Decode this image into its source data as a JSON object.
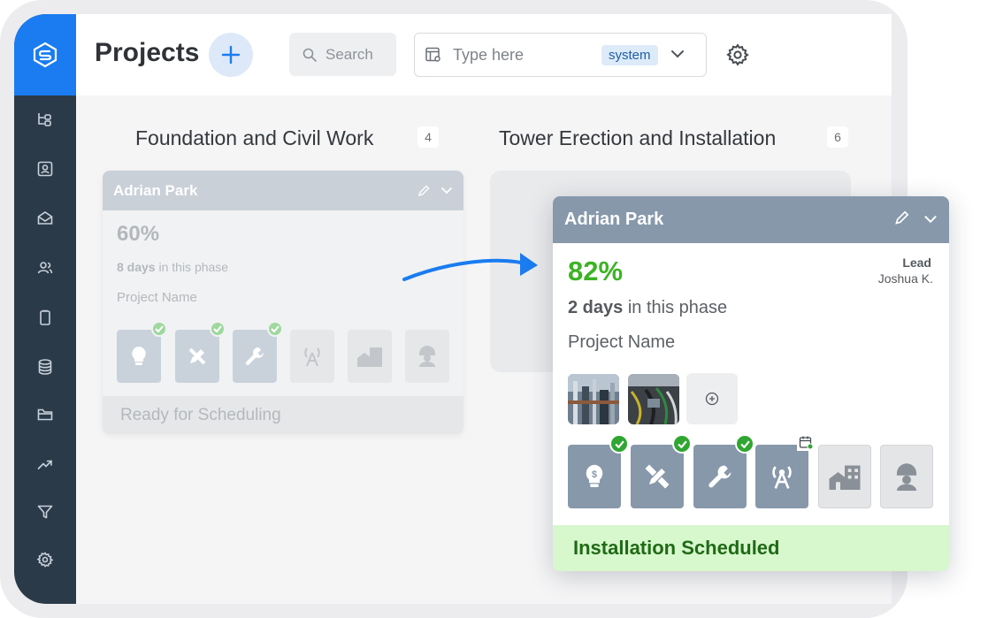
{
  "header": {
    "title": "Projects",
    "search_placeholder": "Search",
    "filter_placeholder": "Type here",
    "filter_tag": "system"
  },
  "sidebar": {
    "items": [
      {
        "icon": "hierarchy-icon"
      },
      {
        "icon": "contact-card-icon"
      },
      {
        "icon": "mail-icon"
      },
      {
        "icon": "users-icon"
      },
      {
        "icon": "clipboard-icon"
      },
      {
        "icon": "database-icon"
      },
      {
        "icon": "folder-icon"
      },
      {
        "icon": "trend-up-icon"
      },
      {
        "icon": "filter-icon"
      },
      {
        "icon": "settings-icon"
      }
    ]
  },
  "columns": [
    {
      "title": "Foundation and Civil Work",
      "count": "4"
    },
    {
      "title": "Tower Erection and Installation",
      "count": "6"
    }
  ],
  "card_faded": {
    "name": "Adrian Park",
    "percent": "60%",
    "days_bold": "8 days",
    "days_rest": " in this phase",
    "project_name": "Project  Name",
    "status": "Ready for Scheduling",
    "stages": [
      {
        "icon": "dollar-bulb-icon",
        "done": true
      },
      {
        "icon": "pencil-ruler-icon",
        "done": true
      },
      {
        "icon": "wrench-icon",
        "done": true
      },
      {
        "icon": "antenna-tower-icon",
        "done": false
      },
      {
        "icon": "buildings-icon",
        "done": false
      },
      {
        "icon": "worker-helmet-icon",
        "done": false
      }
    ]
  },
  "card": {
    "name": "Adrian Park",
    "percent": "82%",
    "lead_label": "Lead",
    "lead_name": "Joshua K.",
    "days_bold": "2 days",
    "days_rest": " in this phase",
    "project_name": "Project  Name",
    "status": "Installation Scheduled",
    "status_color": "#206a15",
    "percent_color": "#3db324",
    "stages": [
      {
        "icon": "dollar-bulb-icon",
        "state": "done"
      },
      {
        "icon": "pencil-ruler-icon",
        "state": "done"
      },
      {
        "icon": "wrench-icon",
        "state": "done"
      },
      {
        "icon": "antenna-tower-icon",
        "state": "scheduled"
      },
      {
        "icon": "buildings-icon",
        "state": "pending"
      },
      {
        "icon": "worker-helmet-icon",
        "state": "pending"
      }
    ]
  },
  "colors": {
    "accent": "#1a7cf0",
    "sidebar": "#2b3a49",
    "card_header": "#8798ab",
    "status_bg": "#d7f7cd"
  }
}
